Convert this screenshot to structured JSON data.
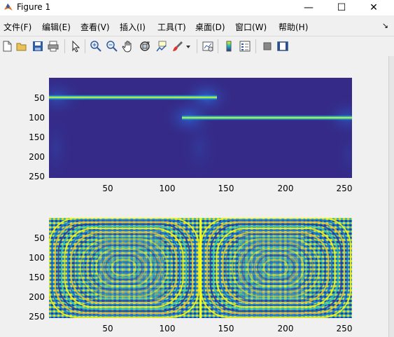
{
  "window": {
    "title": "Figure 1",
    "minimize_glyph": "—",
    "maximize_glyph": "☐",
    "close_glyph": "✕"
  },
  "menu": {
    "items": [
      "文件(F)",
      "编辑(E)",
      "查看(V)",
      "插入(I)",
      "工具(T)",
      "桌面(D)",
      "窗口(W)",
      "帮助(H)"
    ],
    "overflow_glyph": "↘"
  },
  "toolbar": {
    "icons": [
      "new-figure-icon",
      "open-file-icon",
      "save-icon",
      "print-icon",
      "edit-plot-arrow-icon",
      "zoom-in-icon",
      "zoom-out-icon",
      "pan-hand-icon",
      "rotate-3d-icon",
      "data-cursor-icon",
      "brush-icon",
      "brush-dropdown-icon",
      "link-plot-icon",
      "colorbar-icon",
      "legend-icon",
      "hide-plot-tools-icon",
      "show-plot-tools-icon"
    ]
  },
  "axes": [
    {
      "name": "top-image",
      "yticks": [
        "50",
        "100",
        "150",
        "200",
        "250"
      ],
      "xticks": [
        "50",
        "100",
        "150",
        "200",
        "250"
      ]
    },
    {
      "name": "bottom-image",
      "yticks": [
        "50",
        "100",
        "150",
        "200",
        "250"
      ],
      "xticks": [
        "50",
        "100",
        "150",
        "200",
        "250"
      ]
    }
  ],
  "colors": {
    "parula_dark": "#352a87",
    "parula_blue": "#0f5cdd",
    "parula_teal": "#12b8c3",
    "parula_green": "#86c15c",
    "parula_yellow": "#f9fb0e"
  }
}
